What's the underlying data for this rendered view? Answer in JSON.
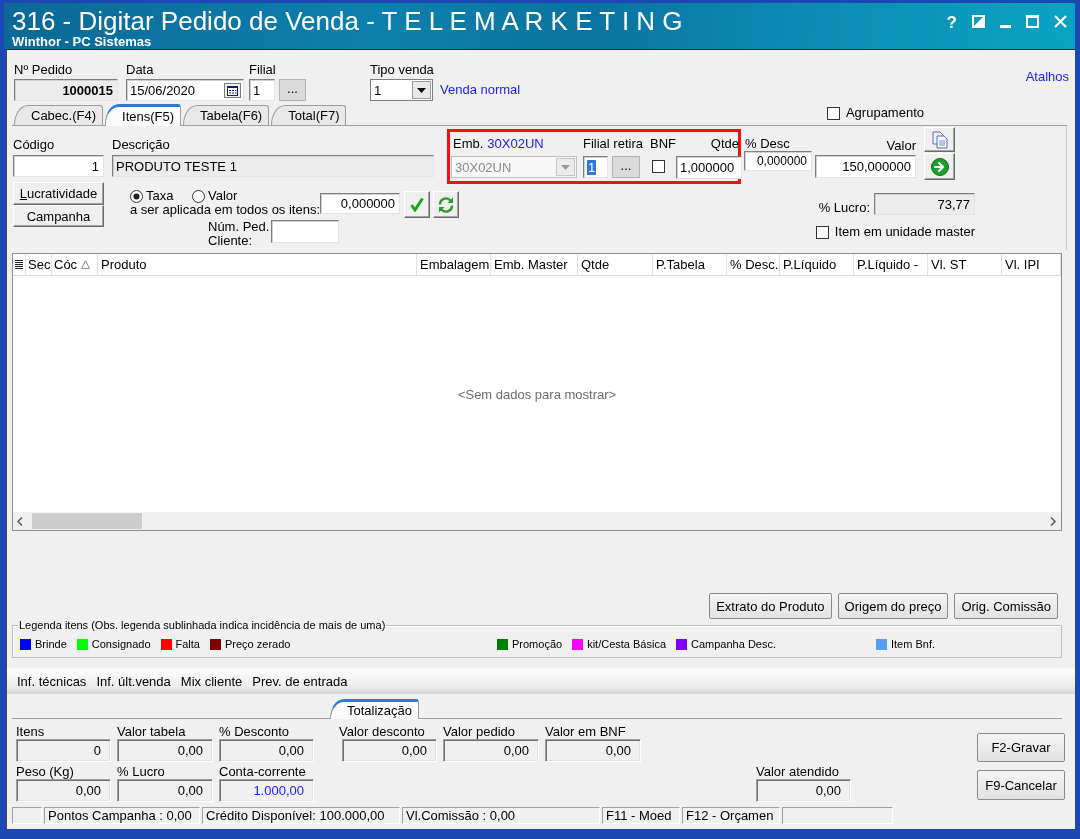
{
  "window": {
    "title": "316 - Digitar Pedido de Venda - T E L E M A R K E T I N G",
    "subtitle": "Winthor - PC Sistemas",
    "help": "?"
  },
  "header": {
    "order_number": {
      "label": "Nº Pedido",
      "value": "1000015"
    },
    "date": {
      "label": "Data",
      "value": "15/06/2020"
    },
    "branch": {
      "label": "Filial",
      "value": "1",
      "button": "..."
    },
    "sale_type": {
      "label": "Tipo venda",
      "value": "1",
      "description": "Venda normal"
    },
    "shortcuts_link": "Atalhos"
  },
  "tabs": [
    {
      "label": "Cabec.(F4)",
      "selected": false
    },
    {
      "label": "Itens(F5)",
      "selected": true
    },
    {
      "label": "Tabela(F6)",
      "selected": false
    },
    {
      "label": "Total(F7)",
      "selected": false
    }
  ],
  "grouping": {
    "label": "Agrupamento",
    "checked": false
  },
  "item_entry": {
    "code": {
      "label": "Código",
      "value": "1"
    },
    "description": {
      "label": "Descrição",
      "value": "PRODUTO TESTE 1"
    },
    "highlight_frame": true,
    "packaging": {
      "label": "Emb.",
      "code": "30X02UN",
      "value": "30X02UN",
      "disabled": true
    },
    "pickup_branch": {
      "label": "Filial retira",
      "value": "1",
      "highlighted": true,
      "button": "..."
    },
    "bnf": {
      "label": "BNF",
      "checked": false
    },
    "quantity": {
      "label": "Qtde",
      "value": "1,000000"
    },
    "discount": {
      "label": "% Desc",
      "value": "0,000000"
    },
    "price": {
      "label": "Valor",
      "value": "150,000000"
    },
    "buttons": [
      {
        "label": "Lucratividade",
        "mnemonic": true
      },
      {
        "label": "Campanha",
        "mnemonic": false
      }
    ],
    "apply_mode": {
      "options": [
        {
          "label": "Taxa",
          "selected": true
        },
        {
          "label": "Valor",
          "selected": false
        }
      ],
      "caption": "a ser aplicada em todos os itens:",
      "value": "0,000000"
    },
    "customer_order": {
      "label_lines": [
        "Núm. Ped.",
        "Cliente:"
      ]
    },
    "profit": {
      "label": "% Lucro:",
      "value": "73,77"
    },
    "master_unit": {
      "label": "Item em unidade master",
      "checked": false
    }
  },
  "grid": {
    "columns": [
      {
        "label": "Sec",
        "sorted": false
      },
      {
        "label": "Cóc",
        "sorted": true
      },
      {
        "label": "Produto",
        "sorted": false
      },
      {
        "label": "Embalagem",
        "sorted": false
      },
      {
        "label": "Emb. Master",
        "sorted": false
      },
      {
        "label": "Qtde",
        "sorted": false
      },
      {
        "label": "P.Tabela",
        "sorted": false
      },
      {
        "label": "% Desc.",
        "sorted": false
      },
      {
        "label": "P.Líquido",
        "sorted": false
      },
      {
        "label": "P.Líquido -",
        "sorted": false
      },
      {
        "label": "Vl. ST",
        "sorted": false
      },
      {
        "label": "Vl. IPI",
        "sorted": false
      }
    ],
    "empty_message": "<Sem dados para mostrar>"
  },
  "actions": [
    "Extrato do Produto",
    "Origem do preço",
    "Orig. Comissão"
  ],
  "legend": {
    "title": "Legenda itens (Obs. legenda sublinhada indica incidência de mais de uma)",
    "groups": [
      {
        "items": [
          {
            "label": "Brinde",
            "color": "#0000ff"
          },
          {
            "label": "Consignado",
            "color": "#00ff00"
          },
          {
            "label": "Falta",
            "color": "#ff0000"
          },
          {
            "label": "Preço zerado",
            "color": "#800000"
          }
        ]
      },
      {
        "items": [
          {
            "label": "Promoção",
            "color": "#008000"
          },
          {
            "label": "kit/Cesta Básica",
            "color": "#ff00ff"
          },
          {
            "label": "Campanha Desc.",
            "color": "#8000ff"
          }
        ]
      },
      {
        "items": [
          {
            "label": "Item Bnf.",
            "color": "#55a0ee"
          }
        ]
      }
    ]
  },
  "info_tabs": [
    "Inf. técnicas",
    "Inf. últ.venda",
    "Mix cliente",
    "Prev. de entrada"
  ],
  "totals": {
    "tab": {
      "label": "Totalização",
      "selected": true
    },
    "left_fields": [
      {
        "label": "Itens",
        "value": "0",
        "emphasis": false
      },
      {
        "label": "Valor tabela",
        "value": "0,00",
        "emphasis": false
      },
      {
        "label": "% Desconto",
        "value": "0,00",
        "emphasis": false
      },
      {
        "label": "Peso (Kg)",
        "value": "0,00",
        "emphasis": false
      },
      {
        "label": "% Lucro",
        "value": "0,00",
        "emphasis": false
      },
      {
        "label": "Conta-corrente",
        "value": "1.000,00",
        "emphasis": true
      }
    ],
    "middle_fields": [
      {
        "label": "Valor desconto",
        "value": "0,00"
      },
      {
        "label": "Valor pedido",
        "value": "0,00"
      },
      {
        "label": "Valor em BNF",
        "value": "0,00"
      }
    ],
    "attended": {
      "label": "Valor atendido",
      "value": "0,00"
    },
    "buttons": [
      "F2-Gravar",
      "F9-Cancelar"
    ]
  },
  "status_bar": {
    "panels": [
      "Pontos Campanha : 0,00",
      "Crédito Disponível: 100.000,00",
      "Vl.Comissão : 0,00",
      "F11 - Moed",
      "F12 - Orçamen"
    ]
  }
}
